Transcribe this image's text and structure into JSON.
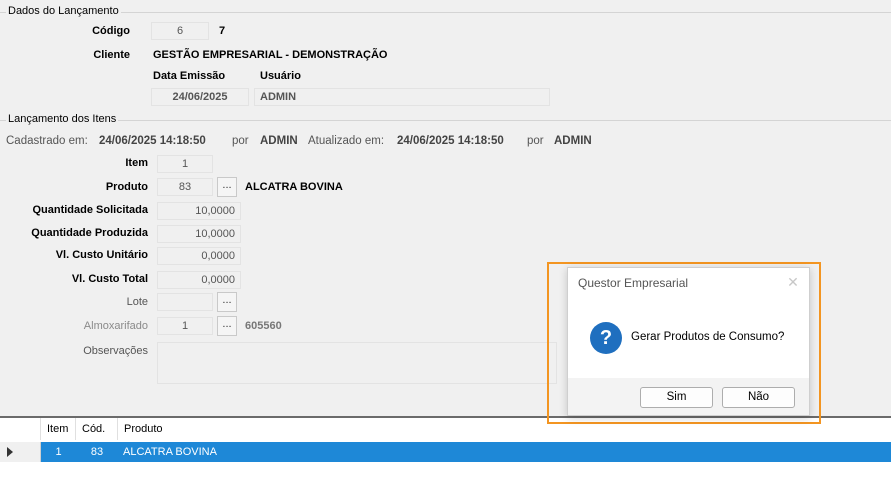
{
  "header_section": {
    "legend": "Dados do Lançamento",
    "codigo_label": "Código",
    "codigo_value": "6",
    "codigo_extra": "7",
    "cliente_label": "Cliente",
    "cliente_value": "GESTÃO EMPRESARIAL - DEMONSTRAÇÃO",
    "data_emissao_label": "Data Emissão",
    "data_emissao_value": "24/06/2025",
    "usuario_label": "Usuário",
    "usuario_value": "ADMIN"
  },
  "items_section": {
    "legend": "Lançamento dos Itens",
    "meta": {
      "cadastrado_label": "Cadastrado em:",
      "cadastrado_value": "24/06/2025 14:18:50",
      "por1_label": "por",
      "por1_value": "ADMIN",
      "atualizado_label": "Atualizado em:",
      "atualizado_value": "24/06/2025 14:18:50",
      "por2_label": "por",
      "por2_value": "ADMIN"
    },
    "item_label": "Item",
    "item_value": "1",
    "produto_label": "Produto",
    "produto_code": "83",
    "produto_name": "ALCATRA BOVINA",
    "qtd_solicitada_label": "Quantidade Solicitada",
    "qtd_solicitada_value": "10,0000",
    "qtd_produzida_label": "Quantidade Produzida",
    "qtd_produzida_value": "10,0000",
    "vl_custo_unit_label": "Vl. Custo Unitário",
    "vl_custo_unit_value": "0,0000",
    "vl_custo_total_label": "Vl. Custo Total",
    "vl_custo_total_value": "0,0000",
    "lote_label": "Lote",
    "lote_value": "",
    "almox_label": "Almoxarifado",
    "almox_code": "1",
    "almox_extra": "605560",
    "obs_label": "Observações",
    "obs_value": "",
    "lookup_label": "..."
  },
  "grid": {
    "columns": [
      "Item",
      "Cód.",
      "Produto"
    ],
    "rows": [
      {
        "item": "1",
        "cod": "83",
        "produto": "ALCATRA BOVINA"
      }
    ]
  },
  "dialog": {
    "title": "Questor Empresarial",
    "message": "Gerar Produtos de Consumo?",
    "yes_label": "Sim",
    "no_label": "Não",
    "close_glyph": "✕",
    "question_glyph": "?",
    "icon": "question-icon"
  },
  "colors": {
    "selection": "#1e88d7",
    "highlight_frame": "#f39521",
    "question_icon": "#1f6fbf"
  }
}
